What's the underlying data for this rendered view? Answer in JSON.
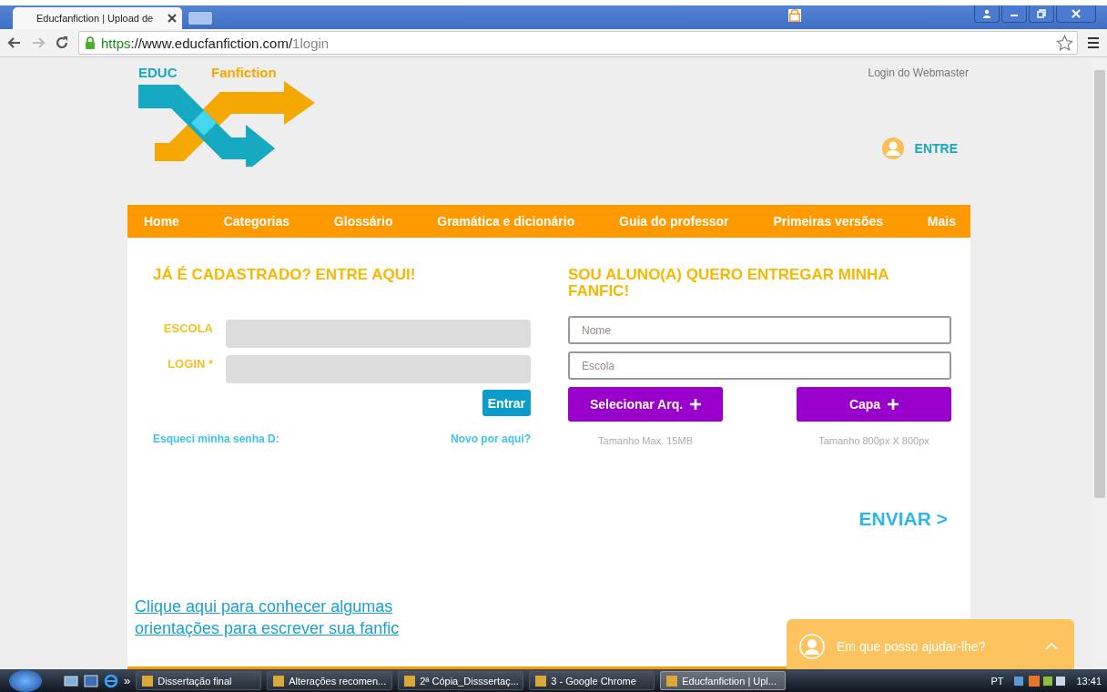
{
  "browser": {
    "tabs": [
      {
        "title": "Educfanfiction | Upload de",
        "selected": true
      }
    ],
    "url": {
      "scheme": "https",
      "host": "://www.educfanfiction.com/",
      "path": "1login"
    }
  },
  "site": {
    "logo": {
      "left": "EDUC",
      "right": "Fanfiction"
    },
    "webmaster_link": "Login do Webmaster",
    "account_button": "ENTRE",
    "nav": [
      "Home",
      "Categorias",
      "Glossário",
      "Gramática e dicionário",
      "Guia do professor",
      "Primeiras versões",
      "Mais"
    ],
    "login": {
      "title": "JÁ É CADASTRADO? ENTRE AQUI!",
      "fields": [
        {
          "label": "ESCOLA"
        },
        {
          "label": "LOGIN *"
        }
      ],
      "submit": "Entrar",
      "forgot": "Esqueci minha senha D:",
      "new_user": "Novo por aqui?"
    },
    "upload": {
      "title": "SOU ALUNO(A) QUERO ENTREGAR MINHA FANFIC!",
      "fields": [
        {
          "placeholder": "Nome"
        },
        {
          "placeholder": "Escola"
        }
      ],
      "buttons": [
        {
          "label": "Selecionar Arq.",
          "hint": "Tamanho Max. 15MB"
        },
        {
          "label": "Capa",
          "hint": "Tamanho 800px X 800px"
        }
      ],
      "submit": "ENVIAR >"
    },
    "guide_link": "Clique aqui para conhecer algumas orientações para escrever sua fanfic",
    "chat": {
      "prompt": "Em que posso ajudar-lhe?"
    }
  },
  "taskbar": {
    "items": [
      {
        "label": "Dissertação final",
        "selected": false
      },
      {
        "label": "Alterações recomen...",
        "selected": false
      },
      {
        "label": "2ª Cópia_Disssertaç...",
        "selected": false
      },
      {
        "label": "3 - Google Chrome",
        "selected": false
      },
      {
        "label": "Educfanfiction | Upl...",
        "selected": true
      }
    ],
    "overflow": "»",
    "language": "PT",
    "clock": "13:41"
  }
}
